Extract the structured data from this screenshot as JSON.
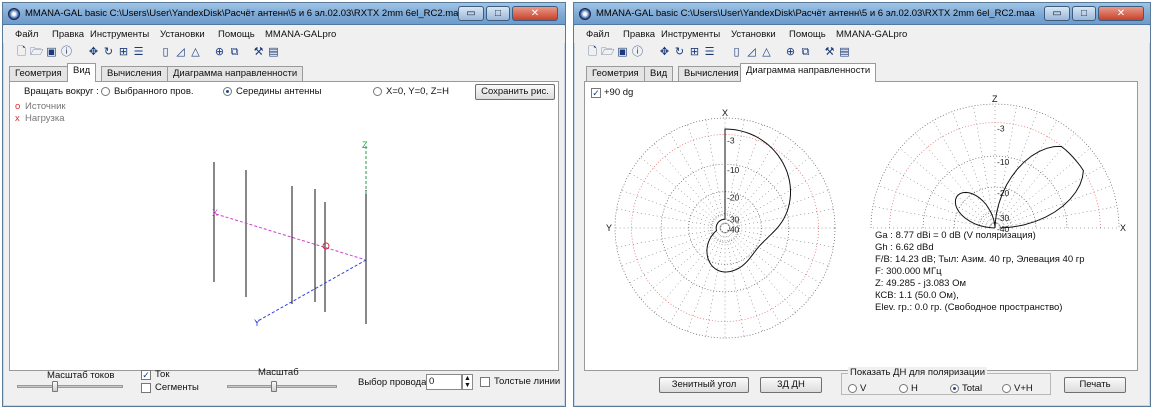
{
  "left_window": {
    "title": "MMANA-GAL basic C:\\Users\\User\\YandexDisk\\Расчёт антенн\\5 и 6 эл.02.03\\RXTX 2mm 6el_RC2.maa",
    "menu": [
      "Файл",
      "Правка",
      "Инструменты",
      "Установки",
      "Помощь",
      "MMANA-GALpro"
    ],
    "tabs": [
      "Геометрия",
      "Вид",
      "Вычисления",
      "Диаграмма направленности"
    ],
    "active_tab": "Вид",
    "rotate_label": "Вращать вокруг :",
    "rotate_options": [
      "Выбранного пров.",
      "Середины антенны",
      "X=0, Y=0, Z=H"
    ],
    "rotate_selected": "Середины антенны",
    "save_button": "Сохранить рис.",
    "legend": {
      "source": "Источник",
      "load": "Нагрузка",
      "source_mark": "o",
      "load_mark": "x"
    },
    "bottom": {
      "current_scale_label": "Масштаб токов",
      "current_label": "Ток",
      "current_checked": true,
      "segments_label": "Сегменты",
      "segments_checked": false,
      "scale_label": "Масштаб",
      "wire_select_label": "Выбор провода",
      "wire_select_value": "0",
      "thick_lines_label": "Толстые линии",
      "thick_lines_checked": false
    }
  },
  "right_window": {
    "title": "MMANA-GAL basic C:\\Users\\User\\YandexDisk\\Расчёт антенн\\5 и 6 эл.02.03\\RXTX 2mm 6el_RC2.maa",
    "menu": [
      "Файл",
      "Правка",
      "Инструменты",
      "Установки",
      "Помощь",
      "MMANA-GALpro"
    ],
    "tabs": [
      "Геометрия",
      "Вид",
      "Вычисления",
      "Диаграмма направленности"
    ],
    "active_tab": "Диаграмма направленности",
    "plus90_label": "+90 dg",
    "plus90_checked": true,
    "polar_left": {
      "top_axis": "X",
      "left_axis": "Y",
      "ring_labels": [
        "-3",
        "-10",
        "-20",
        "-30",
        "-40"
      ]
    },
    "polar_right": {
      "top_axis": "Z",
      "right_axis": "X",
      "ring_labels": [
        "-3",
        "-10",
        "-20",
        "-30",
        "-40"
      ]
    },
    "results": [
      "Ga : 8.77 dBi = 0 dB  (V поляризация)",
      "Gh : 6.62 dBd",
      "F/B: 14.23 dB; Тыл: Азим. 40 гр, Элевация 40 гр",
      "F: 300.000 МГц",
      "Z: 49.285 - j3.083 Ом",
      "КСВ: 1.1 (50.0 Ом),",
      "Elev. гр.: 0.0 гр. (Свободное пространство)"
    ],
    "buttons": {
      "zenith": "Зенитный угол",
      "dn3d": "3Д  ДН",
      "print": "Печать"
    },
    "polarization": {
      "group_label": "Показать ДН для поляризации",
      "options": [
        "V",
        "H",
        "Total",
        "V+H"
      ],
      "selected": "Total"
    }
  },
  "colors": {
    "grid_red": "#e06060",
    "grid_black": "#555555",
    "pattern": "#111111",
    "feed_marker": "#d83030",
    "dim_magenta": "#d040d0",
    "dim_blue": "#3040e0",
    "dim_green": "#20a040"
  }
}
